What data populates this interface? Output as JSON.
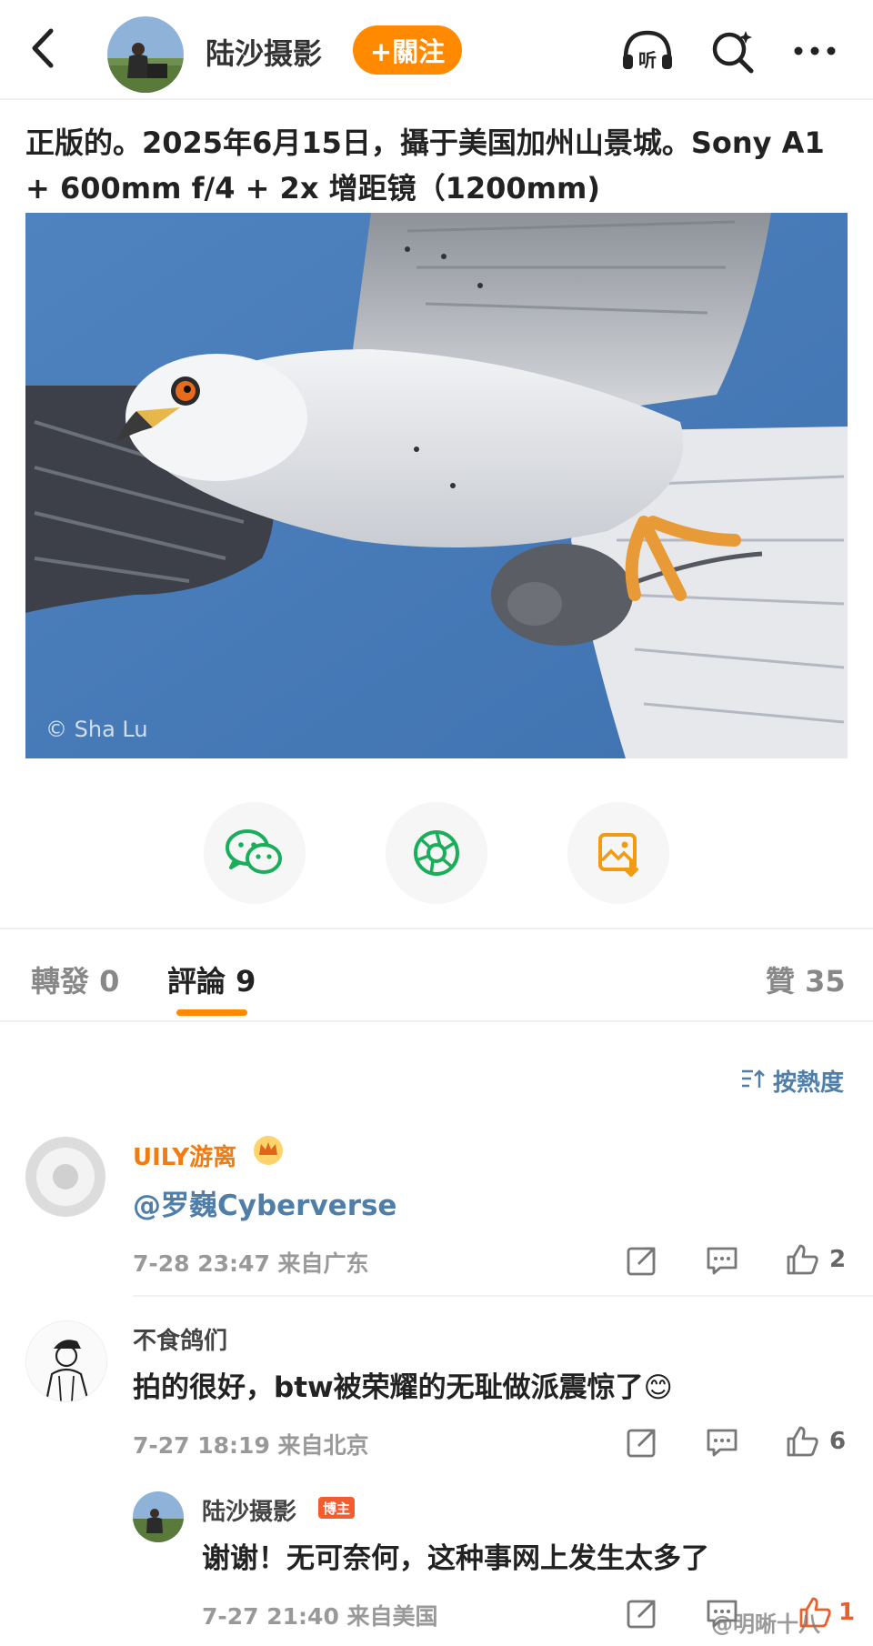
{
  "header": {
    "author": "陆沙摄影",
    "follow_label": "+關注"
  },
  "post": {
    "text": "正版的。2025年6月15日，攝于美国加州山景城。Sony A1 + 600mm f/4 + 2x 增距镜（1200mm)",
    "watermark": "© Sha Lu"
  },
  "tabs": {
    "repost": "轉發 0",
    "comments": "評論 9",
    "likes": "贊 35"
  },
  "sort_label": "按熱度",
  "comments": [
    {
      "name": "UILY游离",
      "body": "@罗巍Cyberverse",
      "meta": "7-28 23:47  来自广东",
      "likes": "2"
    },
    {
      "name": "不食鸽们",
      "body": "拍的很好，btw被荣耀的无耻做派震惊了😊",
      "meta": "7-27 18:19  来自北京",
      "likes": "6"
    },
    {
      "name": "陆沙摄影",
      "badge": "博主",
      "body": "谢谢！无可奈何，这种事网上发生太多了",
      "meta": "7-27 21:40  来自美国",
      "likes": "1"
    }
  ],
  "site_watermark": "@明晰十八",
  "colors": {
    "accent": "#ff8a00",
    "link": "#4f7ea8",
    "vip_name": "#f07c12"
  }
}
